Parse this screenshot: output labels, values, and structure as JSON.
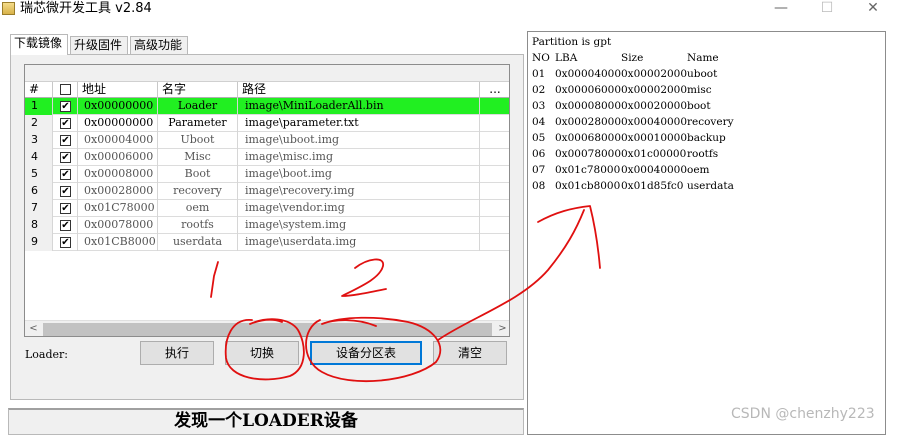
{
  "window": {
    "title": "瑞芯微开发工具 v2.84",
    "minimize_glyph": "—",
    "maximize_glyph": "☐",
    "close_glyph": "✕"
  },
  "tabs": [
    {
      "label": "下载镜像",
      "active": true
    },
    {
      "label": "升级固件",
      "active": false
    },
    {
      "label": "高级功能",
      "active": false
    }
  ],
  "table": {
    "columns": [
      "#",
      "",
      "地址",
      "名字",
      "路径",
      "..."
    ],
    "rows": [
      {
        "no": "1",
        "checked": "✔",
        "address": "0x00000000",
        "name": "Loader",
        "path": "image\\MiniLoaderAll.bin",
        "selected": true
      },
      {
        "no": "2",
        "checked": "✔",
        "address": "0x00000000",
        "name": "Parameter",
        "path": "image\\parameter.txt",
        "selected": false
      },
      {
        "no": "3",
        "checked": "✔",
        "address": "0x00004000",
        "name": "Uboot",
        "path": "image\\uboot.img",
        "selected": false
      },
      {
        "no": "4",
        "checked": "✔",
        "address": "0x00006000",
        "name": "Misc",
        "path": "image\\misc.img",
        "selected": false
      },
      {
        "no": "5",
        "checked": "✔",
        "address": "0x00008000",
        "name": "Boot",
        "path": "image\\boot.img",
        "selected": false
      },
      {
        "no": "6",
        "checked": "✔",
        "address": "0x00028000",
        "name": "recovery",
        "path": "image\\recovery.img",
        "selected": false
      },
      {
        "no": "7",
        "checked": "✔",
        "address": "0x01C78000",
        "name": "oem",
        "path": "image\\vendor.img",
        "selected": false
      },
      {
        "no": "8",
        "checked": "✔",
        "address": "0x00078000",
        "name": "rootfs",
        "path": "image\\system.img",
        "selected": false
      },
      {
        "no": "9",
        "checked": "✔",
        "address": "0x01CB8000",
        "name": "userdata",
        "path": "image\\userdata.img",
        "selected": false
      }
    ],
    "scroll_left_glyph": "<",
    "scroll_right_glyph": ">"
  },
  "loader_label": "Loader:",
  "buttons": {
    "execute": "执行",
    "switch": "切换",
    "partition_table": "设备分区表",
    "clear": "清空"
  },
  "status": "发现一个LOADER设备",
  "output": {
    "header": "Partition is gpt",
    "columns": [
      "NO",
      "LBA",
      "Size",
      "Name"
    ],
    "rows": [
      [
        "01",
        "0x00004000",
        "0x00002000",
        "uboot"
      ],
      [
        "02",
        "0x00006000",
        "0x00002000",
        "misc"
      ],
      [
        "03",
        "0x00008000",
        "0x00020000",
        "boot"
      ],
      [
        "04",
        "0x00028000",
        "0x00040000",
        "recovery"
      ],
      [
        "05",
        "0x00068000",
        "0x00010000",
        "backup"
      ],
      [
        "06",
        "0x00078000",
        "0x01c00000",
        "rootfs"
      ],
      [
        "07",
        "0x01c78000",
        "0x00040000",
        "oem"
      ],
      [
        "08",
        "0x01cb8000",
        "0x01d85fc0",
        "userdata"
      ]
    ]
  },
  "watermark": "CSDN @chenzhy223",
  "colors": {
    "selected_row": "#21ef21",
    "focus_border": "#0078d7",
    "annotation_red": "#e01010"
  }
}
